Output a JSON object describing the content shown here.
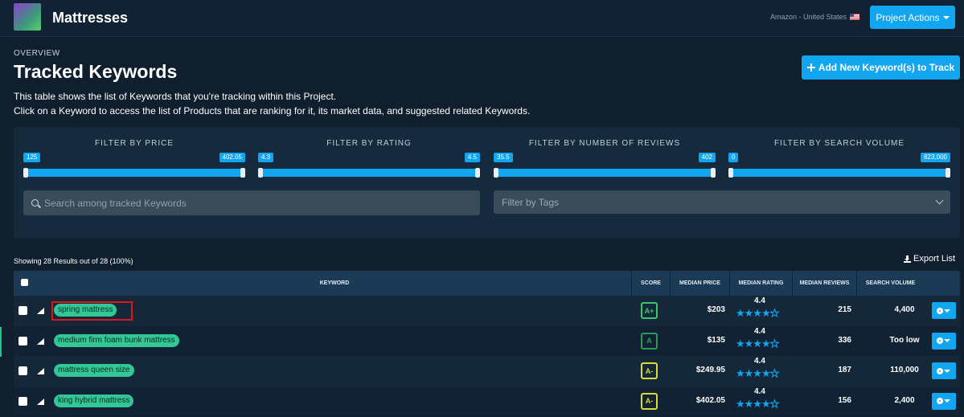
{
  "header": {
    "project_title": "Mattresses",
    "marketplace": "Amazon - United States",
    "project_actions_label": "Project Actions"
  },
  "page": {
    "overview_label": "OVERVIEW",
    "title": "Tracked Keywords",
    "description_1": "This table shows the list of Keywords that you're tracking within this Project.",
    "description_2": "Click on a Keyword to access the list of Products that are ranking for it, its market data, and suggested related Keywords.",
    "add_button_label": "Add New Keyword(s) to Track"
  },
  "filters": {
    "price": {
      "title": "FILTER BY PRICE",
      "min": "125",
      "max": "402.05"
    },
    "rating": {
      "title": "FILTER BY RATING",
      "min": "4.3",
      "max": "4.5"
    },
    "reviews": {
      "title": "FILTER BY NUMBER OF REVIEWS",
      "min": "35.5",
      "max": "402"
    },
    "volume": {
      "title": "FILTER BY SEARCH VOLUME",
      "min": "0",
      "max": "823,000"
    },
    "search_placeholder": "Search among tracked Keywords",
    "tags_placeholder": "Filter by Tags"
  },
  "results": {
    "showing": "Showing 28 Results out of 28 (100%)",
    "export_label": "Export List"
  },
  "table": {
    "headers": {
      "keyword": "KEYWORD",
      "score": "SCORE",
      "median_price": "MEDIAN PRICE",
      "median_rating": "MEDIAN RATING",
      "median_reviews": "MEDIAN REVIEWS",
      "search_volume": "SEARCH VOLUME"
    },
    "rows": [
      {
        "keyword": "spring mattress",
        "score": "A+",
        "price": "$203",
        "rating": "4.4",
        "reviews": "215",
        "volume": "4,400"
      },
      {
        "keyword": "medium firm foam bunk mattress",
        "score": "A",
        "price": "$135",
        "rating": "4.4",
        "reviews": "336",
        "volume": "Too low"
      },
      {
        "keyword": "mattress queen size",
        "score": "A-",
        "price": "$249.95",
        "rating": "4.4",
        "reviews": "187",
        "volume": "110,000"
      },
      {
        "keyword": "king hybrid mattress",
        "score": "A-",
        "price": "$402.05",
        "rating": "4.4",
        "reviews": "156",
        "volume": "2,400"
      }
    ]
  },
  "colors": {
    "accent": "#12a5f0",
    "keyword_pill": "#32c796",
    "background": "#0f1f2e"
  }
}
